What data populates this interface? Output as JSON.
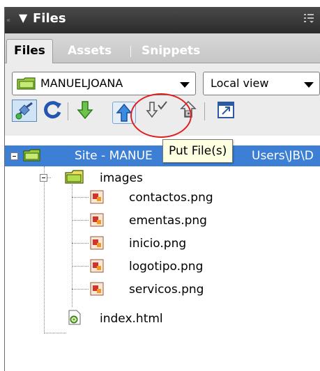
{
  "panel": {
    "title": "Files"
  },
  "tabs": [
    {
      "label": "Files",
      "active": true
    },
    {
      "label": "Assets",
      "active": false
    },
    {
      "label": "Snippets",
      "active": false
    }
  ],
  "toolbar": {
    "site_select": "MANUELJOANA",
    "view_select": "Local view"
  },
  "tooltip": "Put File(s)",
  "tree": {
    "site_label": "Site - MANUE",
    "site_label_tail": "Users\\JB\\D",
    "folder": "images",
    "files": [
      "contactos.png",
      "ementas.png",
      "inicio.png",
      "logotipo.png",
      "servicos.png"
    ],
    "root_file": "index.html"
  },
  "colors": {
    "selection": "#3c7fd4",
    "titlebar": "#2b2b2b",
    "highlight": "#e02020",
    "tooltip_bg": "#ffffe1"
  }
}
